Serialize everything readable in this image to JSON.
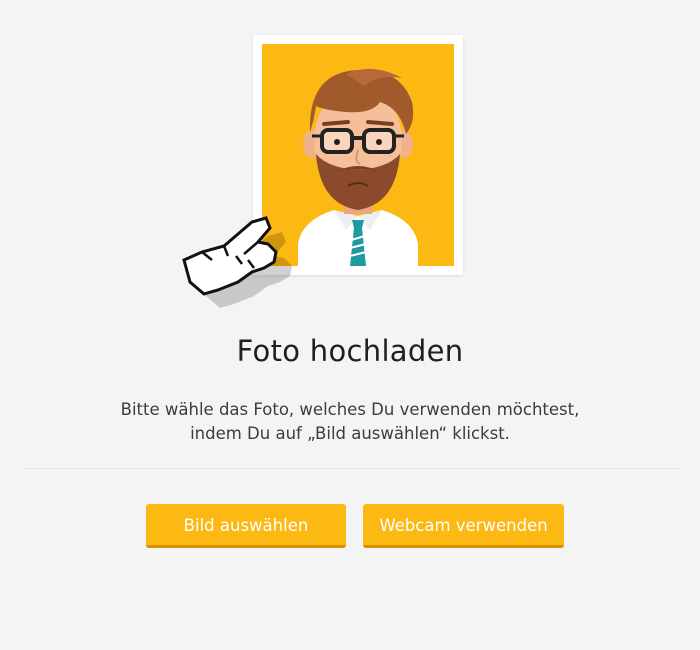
{
  "upload": {
    "title": "Foto hochladen",
    "description_line1": "Bitte wähle das Foto, welches Du verwenden möchtest,",
    "description_line2": "indem Du auf „Bild auswählen“ klickst."
  },
  "buttons": {
    "select_image": "Bild auswählen",
    "use_webcam": "Webcam verwenden"
  },
  "icons": {
    "avatar": "avatar-placeholder-icon",
    "pointer": "hand-pointer-icon"
  },
  "colors": {
    "accent": "#fcb813",
    "accent_shadow": "#d98f00",
    "background": "#f4f4f4"
  }
}
